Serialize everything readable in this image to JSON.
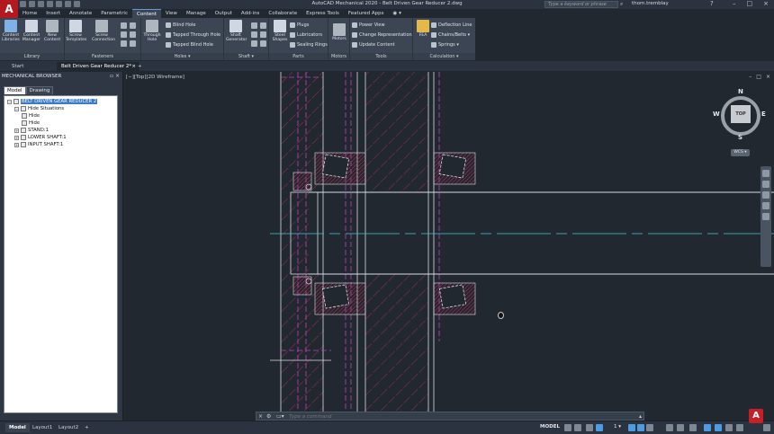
{
  "title_bar": {
    "window_title": "AutoCAD Mechanical 2020 - Belt Driven Gear Reducer 2.dwg",
    "search_placeholder": "Type a keyword or phrase",
    "user": "thom.tremblay",
    "app_logo": "A"
  },
  "ribbon_tabs": [
    "Home",
    "Insert",
    "Annotate",
    "Parametric",
    "Content",
    "View",
    "Manage",
    "Output",
    "Add-ins",
    "Collaborate",
    "Express Tools",
    "Featured Apps",
    "◉ ▾"
  ],
  "active_ribbon_tab": "Content",
  "ribbon": {
    "library": {
      "title": "Library",
      "content_libraries": "Content Libraries",
      "content_manager": "Content Manager",
      "new_content": "New Content"
    },
    "fasteners": {
      "title": "Fasteners",
      "screw_templates": "Screw Templates",
      "screw_connection": "Screw Connection"
    },
    "holes": {
      "title": "Holes ▾",
      "through_hole": "Through Hole",
      "blind_hole": "Blind Hole",
      "tapped_through_hole": "Tapped Through Hole",
      "tapped_blind_hole": "Tapped Blind Hole"
    },
    "shaft": {
      "title": "Shaft ▾",
      "shaft_generator": "Shaft Generator"
    },
    "parts": {
      "title": "Parts",
      "steel_shapes": "Steel Shapes",
      "plugs": "Plugs",
      "lubricators": "Lubricators",
      "sealing_rings": "Sealing Rings"
    },
    "motors": {
      "title": "Motors",
      "motors": "Motors"
    },
    "tools": {
      "title": "Tools",
      "power_view": "Power View",
      "change_representation": "Change Representation",
      "update_content": "Update Content"
    },
    "calculation": {
      "title": "Calculation ▾",
      "fea": "FEA",
      "deflection_line": "Deflection Line",
      "chains_belts": "Chains/Belts ▾",
      "springs": "Springs ▾"
    }
  },
  "doc_tabs": {
    "start": "Start",
    "active": "Belt Driven Gear Reducer 2*",
    "close": "×",
    "add": "+"
  },
  "browser": {
    "title": "MECHANICAL BROWSER",
    "tabs": [
      "Model",
      "Drawing"
    ],
    "active_tab": "Model",
    "tree": [
      {
        "label": "BELT DRIVEN GEAR REDUCER 2",
        "level": 0,
        "expander": "−",
        "selected": true
      },
      {
        "label": "Hide Situations",
        "level": 1,
        "expander": "−",
        "selected": false
      },
      {
        "label": "Hide",
        "level": 2,
        "expander": "",
        "selected": false
      },
      {
        "label": "Hide",
        "level": 2,
        "expander": "",
        "selected": false
      },
      {
        "label": "STAND:1",
        "level": 1,
        "expander": "+",
        "selected": false
      },
      {
        "label": "LOWER SHAFT:1",
        "level": 1,
        "expander": "+",
        "selected": false
      },
      {
        "label": "INPUT SHAFT:1",
        "level": 1,
        "expander": "+",
        "selected": false
      }
    ]
  },
  "viewport": {
    "label": "[−][Top][2D Wireframe]",
    "viewcube": {
      "n": "N",
      "s": "S",
      "e": "E",
      "w": "W",
      "top": "TOP"
    },
    "wcs": "WCS ▾"
  },
  "command_line": {
    "placeholder": "Type a command"
  },
  "status_bar": {
    "layout_tabs": [
      "Model",
      "Layout1",
      "Layout2"
    ],
    "active_layout": "Model",
    "add_layout": "+",
    "model_label": "MODEL",
    "scale": "1 ▾"
  },
  "colors": {
    "accent": "#5a9bd5",
    "viewport_bg": "#212830",
    "hatch": "#c0305a",
    "magenta": "#c040c0",
    "centerline": "#40c8d8"
  }
}
